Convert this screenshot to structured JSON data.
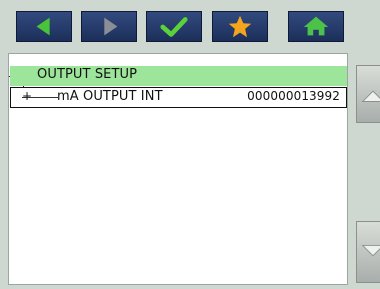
{
  "toolbar": {
    "buttons": [
      {
        "name": "back",
        "icon": "arrow-left-icon",
        "color": "#48c43a"
      },
      {
        "name": "forward",
        "icon": "arrow-right-icon",
        "color": "#8a8f95"
      },
      {
        "name": "confirm",
        "icon": "checkmark-icon",
        "color": "#5bd238"
      },
      {
        "name": "favorite",
        "icon": "star-icon",
        "color": "#f3a51e"
      },
      {
        "name": "home",
        "icon": "home-icon",
        "color": "#4cc24a"
      }
    ]
  },
  "tree": {
    "section_label": "OUTPUT SETUP",
    "row_label": "mA OUTPUT INT",
    "row_value": "000000013992"
  },
  "colors": {
    "background": "#cfd8d0",
    "header_fill": "#9de59b",
    "toolbar_button": "#1c2f5a"
  }
}
